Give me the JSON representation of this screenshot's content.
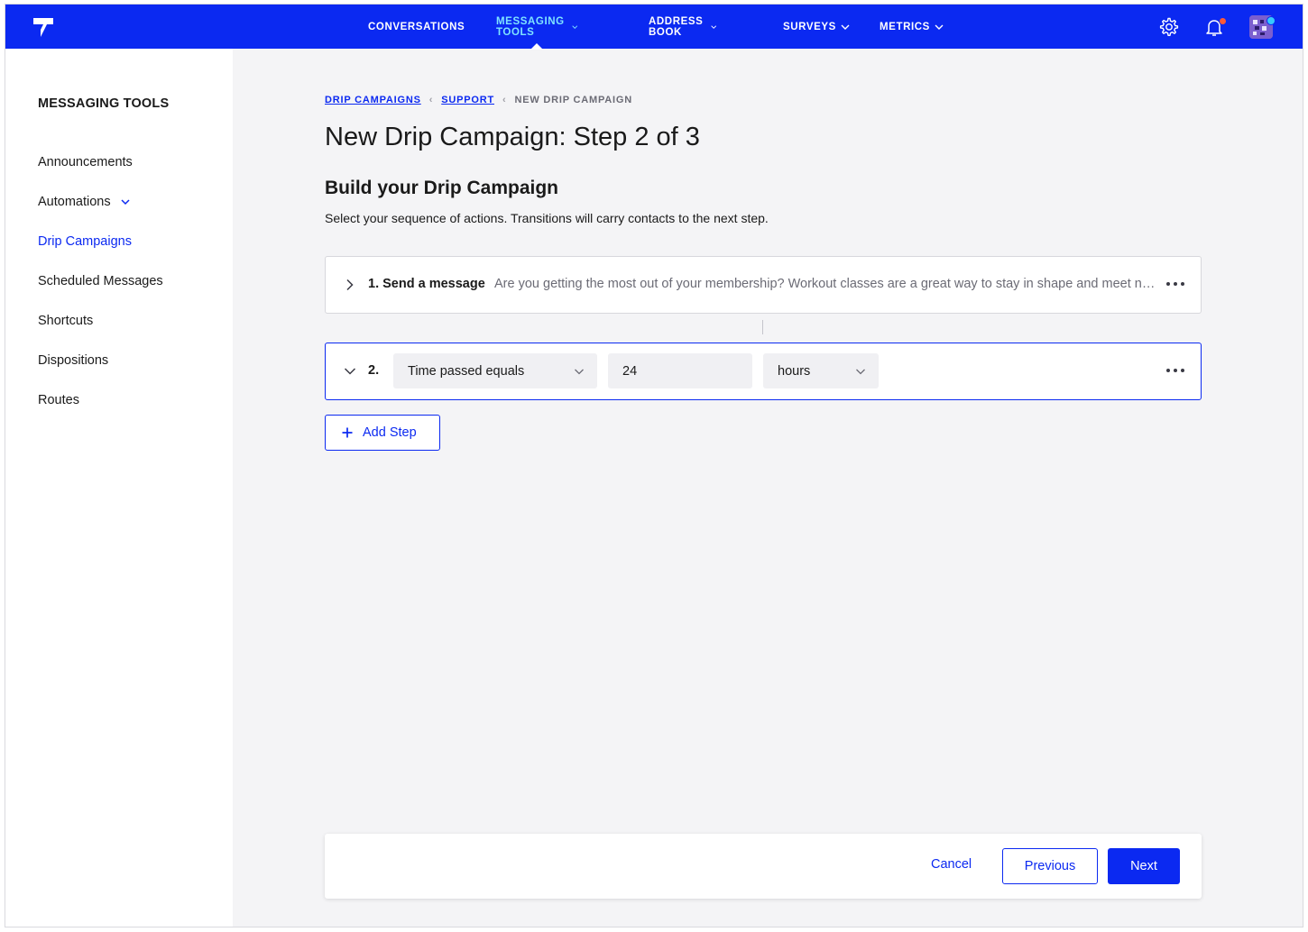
{
  "topnav": {
    "items": [
      {
        "label": "CONVERSATIONS"
      },
      {
        "label": "MESSAGING TOOLS"
      },
      {
        "label": "ADDRESS BOOK"
      },
      {
        "label": "SURVEYS"
      },
      {
        "label": "METRICS"
      }
    ],
    "active_index": 1,
    "icons": [
      "logo-icon",
      "gear-icon",
      "bell-icon",
      "avatar"
    ],
    "colors": {
      "bar": "#0b29f1",
      "active": "#7fe3ff",
      "notification_dot": "#ff5a36",
      "presence_dot": "#35c8ff"
    }
  },
  "sidebar": {
    "title": "MESSAGING TOOLS",
    "items": [
      {
        "label": "Announcements"
      },
      {
        "label": "Automations"
      },
      {
        "label": "Drip Campaigns"
      },
      {
        "label": "Scheduled Messages"
      },
      {
        "label": "Shortcuts"
      },
      {
        "label": "Dispositions"
      },
      {
        "label": "Routes"
      }
    ],
    "active_index": 2
  },
  "breadcrumb": {
    "items": [
      "DRIP CAMPAIGNS",
      "SUPPORT"
    ],
    "current": "NEW DRIP CAMPAIGN"
  },
  "page": {
    "title": "New Drip Campaign: Step 2 of 3",
    "section_title": "Build your Drip Campaign",
    "section_desc": "Select your sequence of actions. Transitions will carry contacts to the next step."
  },
  "steps": {
    "step1": {
      "label": "1. Send a message",
      "preview": "Are you getting the most out of your membership? Workout classes are a great way to stay in shape and meet new people."
    },
    "step2": {
      "number": "2.",
      "condition": "Time passed equals",
      "value": "24",
      "unit": "hours"
    },
    "add_step_label": "Add Step"
  },
  "footer": {
    "cancel": "Cancel",
    "previous": "Previous",
    "next": "Next"
  }
}
